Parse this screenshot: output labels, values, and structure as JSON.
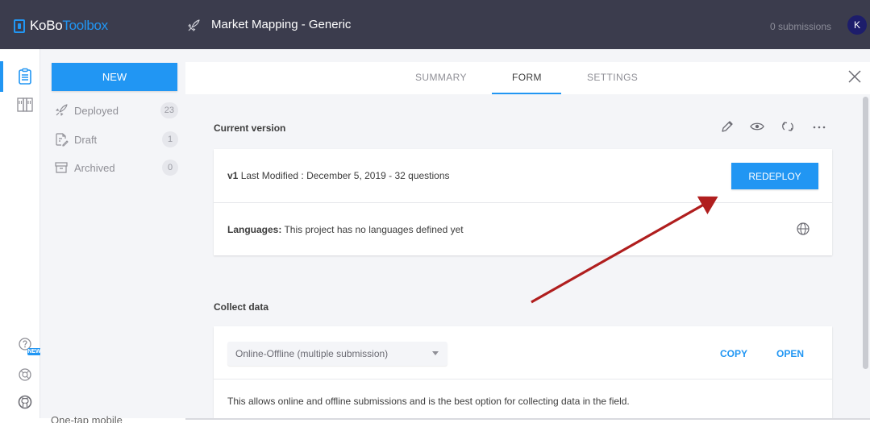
{
  "header": {
    "logo_prefix": "KoBo",
    "logo_suffix": "Toolbox",
    "project_title": "Market Mapping  - Generic",
    "submissions": "0 submissions",
    "avatar_letter": "K"
  },
  "rail": {
    "items": [
      "projects-icon",
      "library-icon"
    ],
    "bottom": [
      "help-icon",
      "support-icon",
      "github-icon"
    ],
    "new_badge": "NEW"
  },
  "sidebar": {
    "new_button": "NEW",
    "items": [
      {
        "label": "Deployed",
        "count": "23",
        "icon": "rocket-icon"
      },
      {
        "label": "Draft",
        "count": "1",
        "icon": "draft-icon"
      },
      {
        "label": "Archived",
        "count": "0",
        "icon": "archive-icon"
      }
    ]
  },
  "tabs": {
    "summary": "SUMMARY",
    "form": "FORM",
    "settings": "SETTINGS",
    "active": "FORM"
  },
  "current_version": {
    "heading": "Current version",
    "version_label": "v1",
    "version_text": "Last Modified : December 5, 2019 - 32 questions",
    "redeploy": "REDEPLOY",
    "languages_label": "Languages:",
    "languages_text": "This project has no languages defined yet"
  },
  "collect_data": {
    "heading": "Collect data",
    "select_value": "Online-Offline (multiple submission)",
    "copy": "COPY",
    "open": "OPEN",
    "description": "This allows online and offline submissions and is the best option for collecting data in the field."
  },
  "footer": {
    "cut_text": "One-tap mobile"
  },
  "colors": {
    "accent": "#2196f3",
    "header_bg": "#3b3c4d",
    "panel_bg": "#f4f5f8",
    "annotation_arrow": "#b01e1e"
  }
}
